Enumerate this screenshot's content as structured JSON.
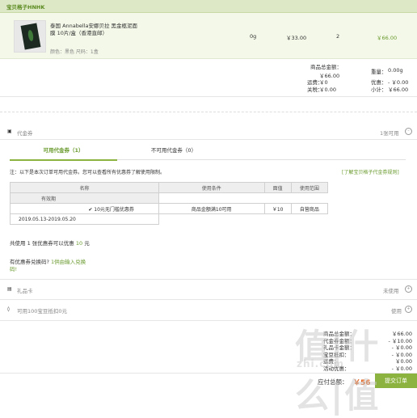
{
  "store": {
    "name": "宝贝格子HNHK"
  },
  "product": {
    "name": "泰国 Annabella安娜贝拉 黑金柩泥面膜 10片/盒（香港直邮）",
    "attrs": "颜色：黑色   尺码：1盒",
    "weight": "0g",
    "price": "￥33.00",
    "qty": "2",
    "subtotal": "￥66.00"
  },
  "summary": {
    "total_label": "商品总金额：",
    "total": "￥66.00",
    "shipping_label": "运费：",
    "shipping": "￥0",
    "tax_label": "关税：",
    "tax": "￥0.00",
    "weight_label": "重量：",
    "weight": "0.00g",
    "discount_label": "优惠：",
    "discount": "- ￥0.00",
    "subtotal_label": "小计：",
    "subtotal": "￥66.00"
  },
  "voucher": {
    "title": "代金券",
    "count": "1张可用",
    "tab_available": "可用代金券（1）",
    "tab_unavailable": "不可用代金券（0）",
    "note": "注：以下是本次订单可用代金券。您可以查看所有优惠券了解使用限制。",
    "rules_link": "[了解宝贝格子代金券规则]",
    "headers": [
      "名称",
      "使用条件",
      "面值",
      "使用范围"
    ],
    "validity_header": "有效期",
    "row": {
      "name": "10元无门槛优惠券",
      "condition": "商品金额满10可用",
      "value": "￥10",
      "scope": "自营商品",
      "validity": "2019.05.13-2019.05.20"
    },
    "summary_text": "共使用 1 张优惠券可以优惠",
    "summary_amount": "10",
    "summary_unit": "元",
    "code_question": "有优惠券兑换码?",
    "code_link": "1供由输入兑换码!"
  },
  "giftcard": {
    "title": "礼品卡",
    "status": "未使用"
  },
  "points": {
    "title": "可用100宝豆抵扣0元",
    "status": "使用"
  },
  "totals": {
    "rows": [
      {
        "label": "商品总金额：",
        "value": "￥66.00"
      },
      {
        "label": "代金券金额：",
        "value": "- ￥10.00"
      },
      {
        "label": "礼品卡金额：",
        "value": "- ￥0.00"
      },
      {
        "label": "宝豆抵扣：",
        "value": "- ￥0.00"
      },
      {
        "label": "运费：",
        "value": "￥0.00"
      },
      {
        "label": "活动优惠：",
        "value": "- ￥0.00"
      }
    ],
    "pay_label": "应付总额：",
    "pay_amount": "￥56",
    "submit": "提交订单"
  },
  "watermark": {
    "big": "值|什么|值",
    "small": "zhi.com"
  }
}
